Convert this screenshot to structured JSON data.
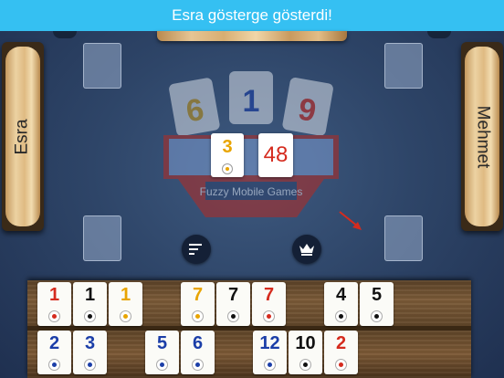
{
  "banner": {
    "text": "Esra gösterge gösterdi!"
  },
  "players": {
    "left": "Esra",
    "right": "Mehmet"
  },
  "logo": {
    "tiles": [
      "6",
      "1",
      "9"
    ],
    "brand": "Fuzzy Mobile Games"
  },
  "center": {
    "indicator": {
      "number": "3",
      "color": "#e8a400"
    },
    "remaining": "48"
  },
  "buttons": {
    "sort": "sort-icon",
    "crown": "crown-icon"
  },
  "colors": {
    "red": "#d52b1e",
    "black": "#111111",
    "yellow": "#e8a400",
    "blue": "#1b3ea8"
  },
  "rack": {
    "top_row": [
      {
        "number": "1",
        "color": "red"
      },
      {
        "number": "1",
        "color": "black"
      },
      {
        "number": "1",
        "color": "yellow"
      },
      {
        "number": "7",
        "color": "yellow"
      },
      {
        "number": "7",
        "color": "black"
      },
      {
        "number": "7",
        "color": "red"
      },
      {
        "number": "4",
        "color": "black"
      },
      {
        "number": "5",
        "color": "black"
      }
    ],
    "bottom_row": [
      {
        "number": "2",
        "color": "blue"
      },
      {
        "number": "3",
        "color": "blue"
      },
      {
        "number": "5",
        "color": "blue"
      },
      {
        "number": "6",
        "color": "blue"
      },
      {
        "number": "12",
        "color": "blue"
      },
      {
        "number": "10",
        "color": "black"
      },
      {
        "number": "2",
        "color": "red"
      }
    ]
  }
}
